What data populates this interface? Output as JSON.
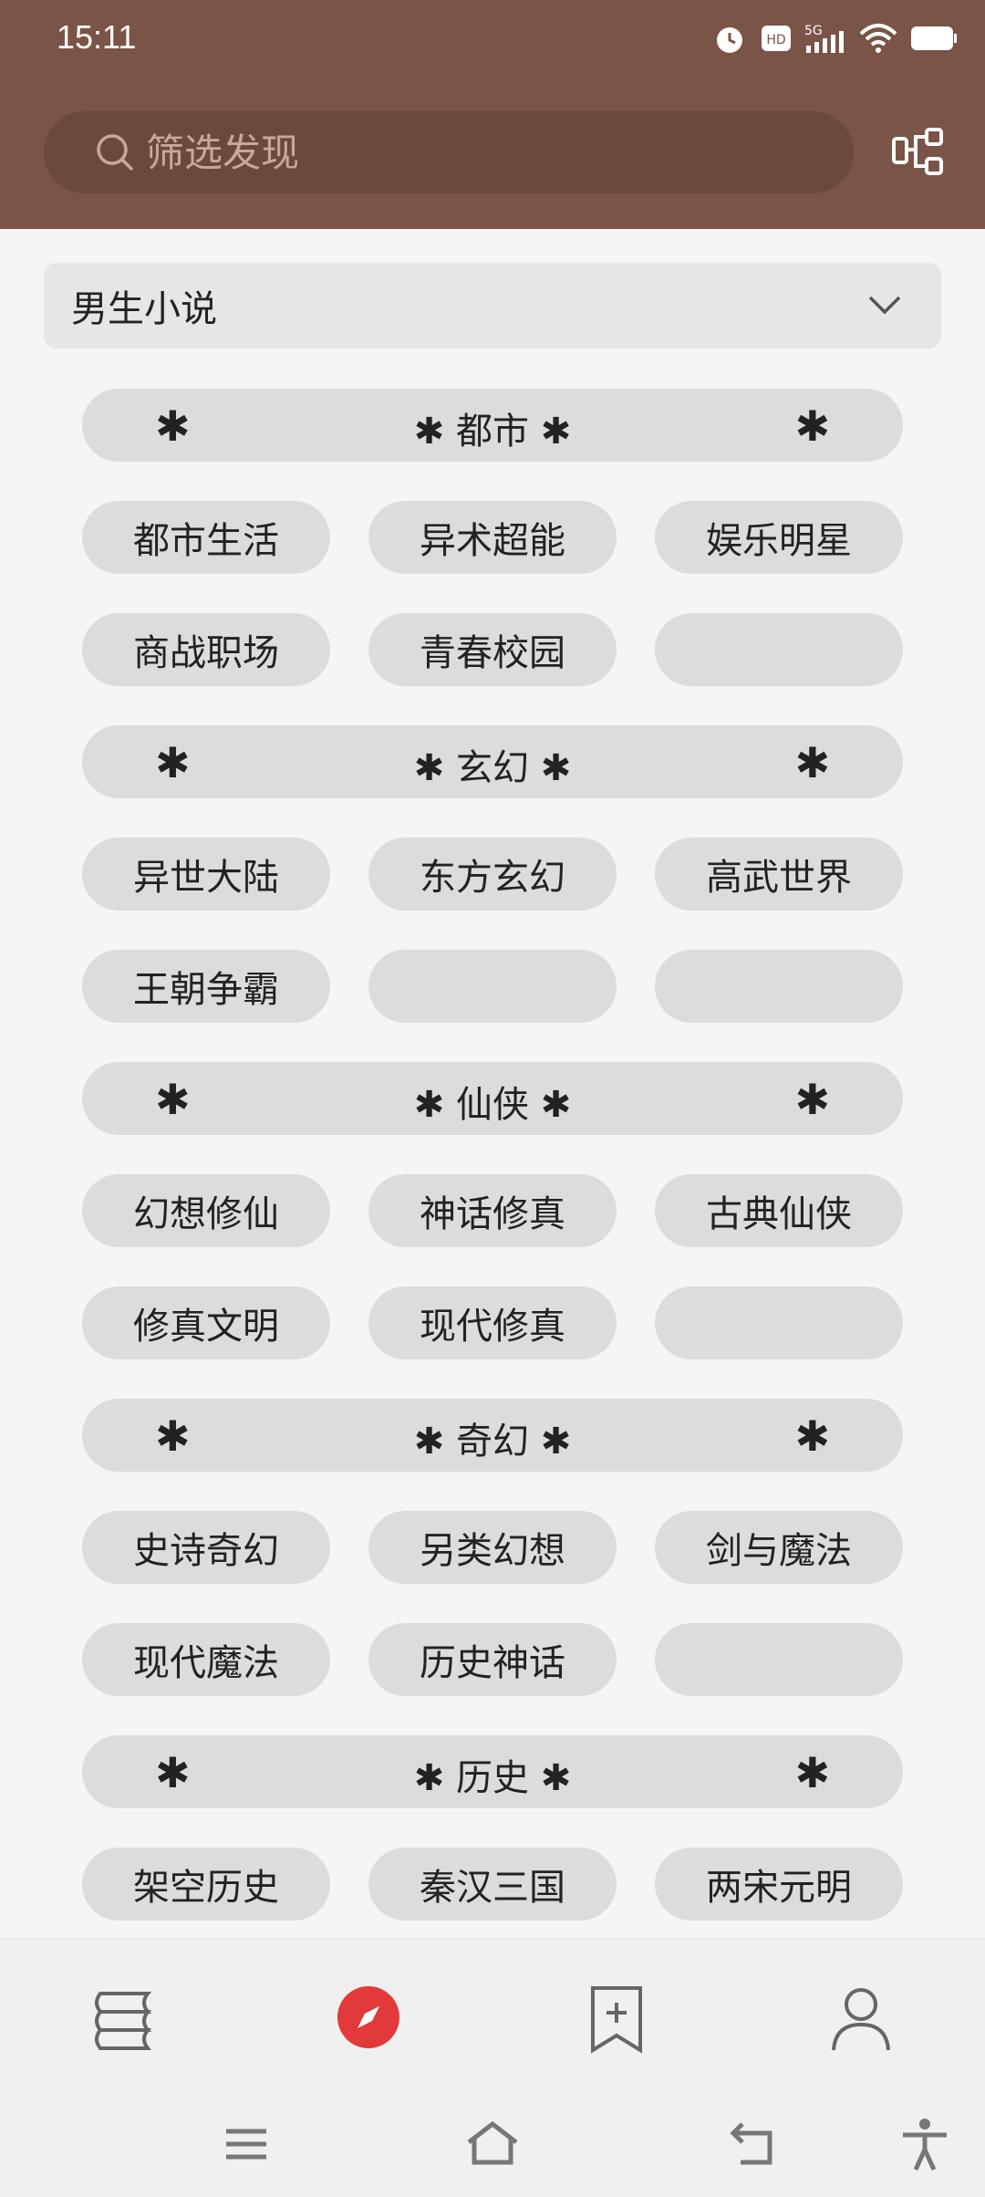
{
  "status": {
    "time": "15:11"
  },
  "search": {
    "placeholder": "筛选发现"
  },
  "dropdown": {
    "selected": "男生小说"
  },
  "sections": [
    {
      "title": "都市",
      "items": [
        "都市生活",
        "异术超能",
        "娱乐明星",
        "商战职场",
        "青春校园",
        ""
      ]
    },
    {
      "title": "玄幻",
      "items": [
        "异世大陆",
        "东方玄幻",
        "高武世界",
        "王朝争霸",
        "",
        ""
      ]
    },
    {
      "title": "仙侠",
      "items": [
        "幻想修仙",
        "神话修真",
        "古典仙侠",
        "修真文明",
        "现代修真",
        ""
      ]
    },
    {
      "title": "奇幻",
      "items": [
        "史诗奇幻",
        "另类幻想",
        "剑与魔法",
        "现代魔法",
        "历史神话",
        ""
      ]
    },
    {
      "title": "历史",
      "items": [
        "架空历史",
        "秦汉三国",
        "两宋元明"
      ]
    }
  ],
  "icons": {
    "search": "search-icon",
    "flow": "flow-icon",
    "chevron": "chevron-down-icon",
    "bookshelf": "bookshelf-icon",
    "discover": "compass-icon",
    "bookmark": "bookmark-add-icon",
    "profile": "user-icon"
  },
  "colors": {
    "header": "#7a5446",
    "accent": "#e23a3a",
    "tag_bg": "#dcdcdc"
  }
}
